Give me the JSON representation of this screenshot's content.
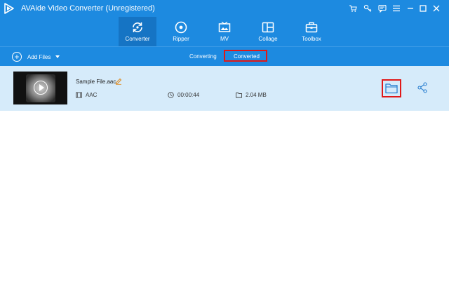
{
  "window": {
    "title": "AVAide Video Converter (Unregistered)",
    "controls": [
      "cart-icon",
      "key-icon",
      "chat-icon",
      "menu-icon",
      "minimize-icon",
      "maximize-icon",
      "close-icon"
    ]
  },
  "main_tabs": [
    {
      "label": "Converter",
      "icon": "converter-icon",
      "active": true
    },
    {
      "label": "Ripper",
      "icon": "ripper-icon",
      "active": false
    },
    {
      "label": "MV",
      "icon": "mv-icon",
      "active": false
    },
    {
      "label": "Collage",
      "icon": "collage-icon",
      "active": false
    },
    {
      "label": "Toolbox",
      "icon": "toolbox-icon",
      "active": false
    }
  ],
  "toolbar": {
    "add_files_label": "Add Files",
    "sub_tabs": [
      {
        "label": "Converting",
        "active": false
      },
      {
        "label": "Converted",
        "active": true
      }
    ]
  },
  "files": [
    {
      "name": "Sample File.aac",
      "format": "AAC",
      "duration": "00:00:44",
      "size": "2.04 MB"
    }
  ],
  "colors": {
    "brand_blue": "#1d8ae0",
    "active_tab": "#1574c4",
    "row_bg": "#d6ebfa",
    "highlight": "#e01818"
  }
}
